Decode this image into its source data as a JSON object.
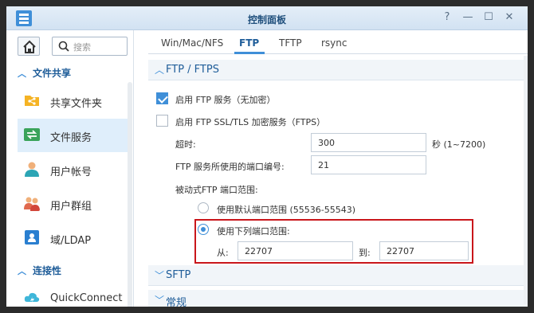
{
  "window": {
    "title": "控制面板",
    "help_glyph": "?",
    "minimize_glyph": "—",
    "maximize_glyph": "☐",
    "close_glyph": "✕"
  },
  "sidebar": {
    "search_placeholder": "搜索",
    "sections": [
      {
        "label": "文件共享",
        "items": [
          {
            "label": "共享文件夹",
            "icon": "shared-folder-icon"
          },
          {
            "label": "文件服务",
            "icon": "file-services-icon",
            "active": true
          },
          {
            "label": "用户帐号",
            "icon": "user-icon"
          },
          {
            "label": "用户群组",
            "icon": "group-icon"
          },
          {
            "label": "域/LDAP",
            "icon": "domain-ldap-icon"
          }
        ]
      },
      {
        "label": "连接性",
        "items": [
          {
            "label": "QuickConnect",
            "icon": "quickconnect-icon"
          }
        ]
      }
    ]
  },
  "tabs": [
    {
      "label": "Win/Mac/NFS"
    },
    {
      "label": "FTP",
      "active": true
    },
    {
      "label": "TFTP"
    },
    {
      "label": "rsync"
    }
  ],
  "ftp": {
    "section_title": "FTP / FTPS",
    "enable_ftp": {
      "label": "启用 FTP 服务（无加密）",
      "checked": true
    },
    "enable_ftps": {
      "label": "启用 FTP SSL/TLS 加密服务（FTPS）",
      "checked": false
    },
    "timeout": {
      "label": "超时:",
      "value": "300",
      "unit": "秒 (1~7200)"
    },
    "port": {
      "label": "FTP 服务所使用的端口编号:",
      "value": "21"
    },
    "passive": {
      "label": "被动式FTP 端口范围:",
      "default_range": {
        "label": "使用默认端口范围 (55536-55543)",
        "selected": false
      },
      "custom_range": {
        "label": "使用下列端口范围:",
        "selected": true
      },
      "from_label": "从:",
      "from_value": "22707",
      "to_label": "到:",
      "to_value": "22707"
    }
  },
  "sftp_title": "SFTP",
  "general_title": "常规"
}
